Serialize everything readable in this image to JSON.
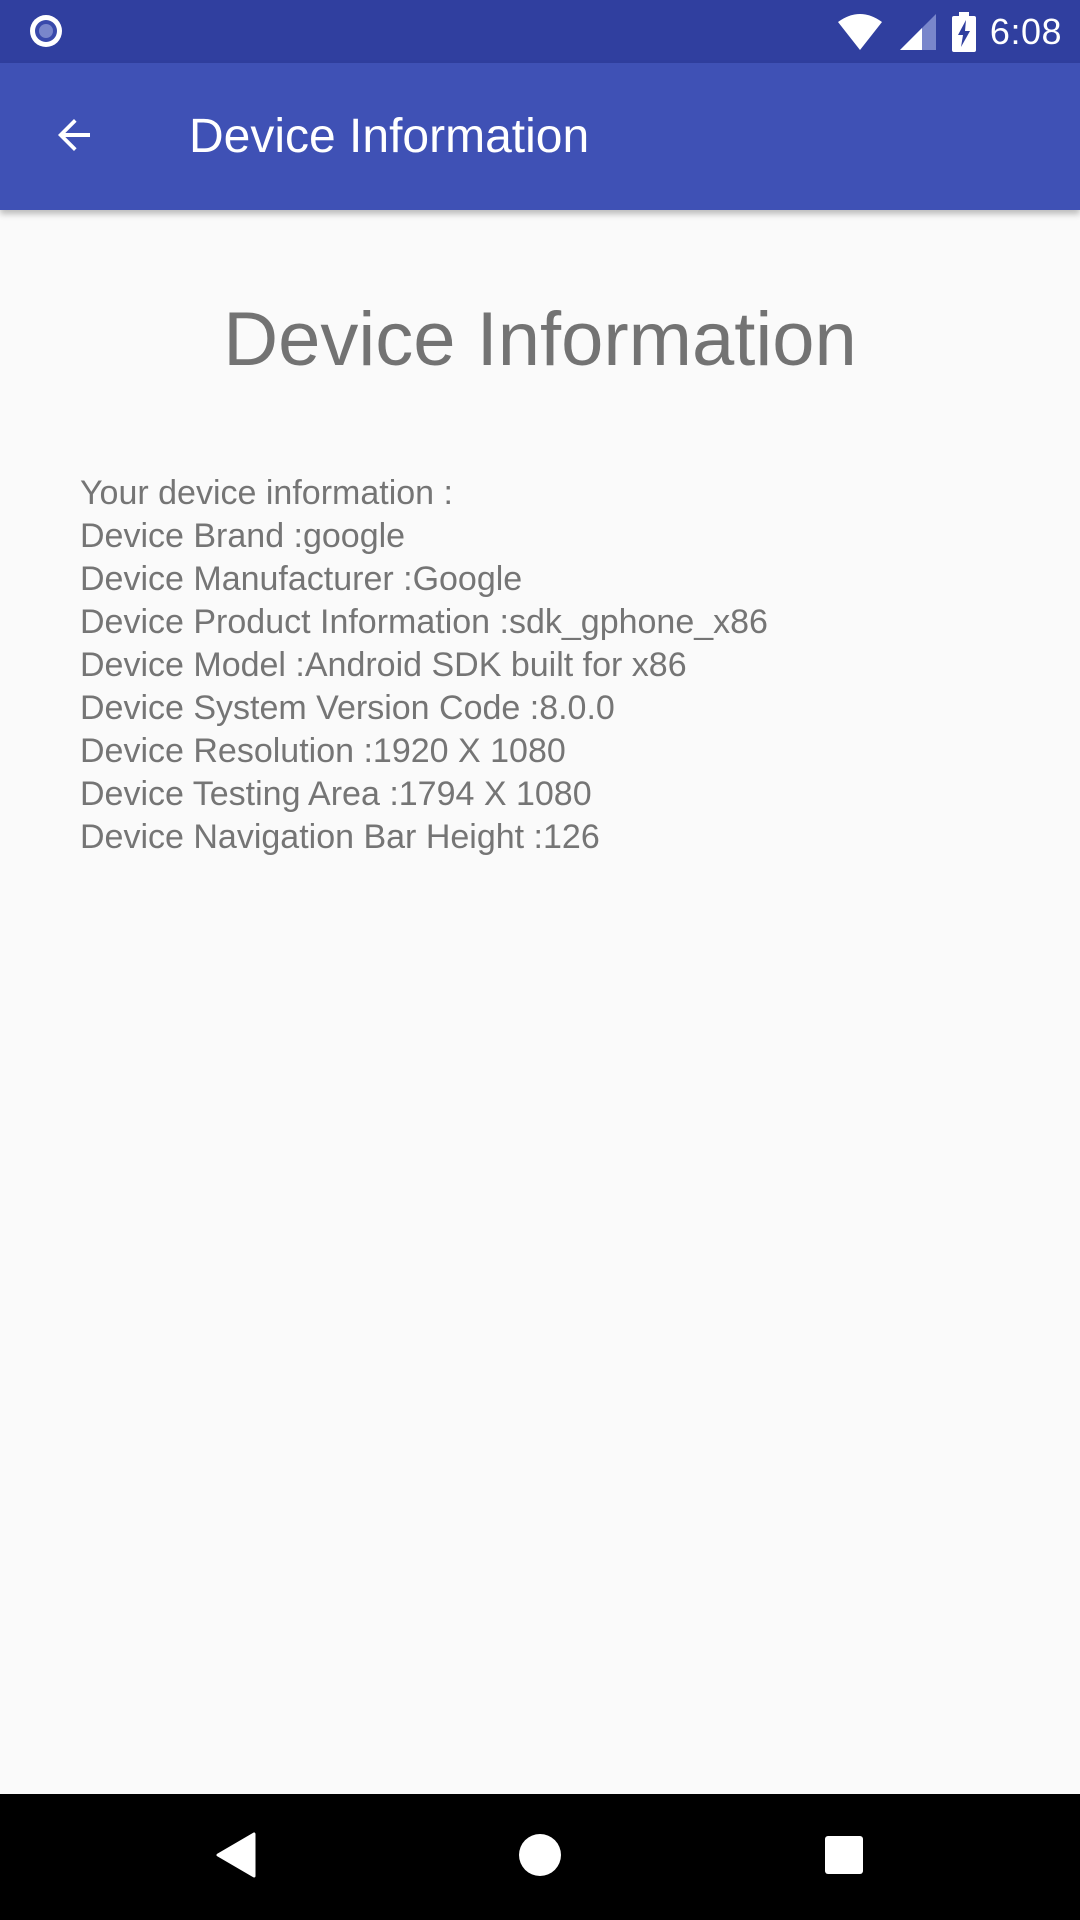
{
  "status_bar": {
    "time": "6:08",
    "left_icon": "sync-circle-icon",
    "icons": [
      "wifi-icon",
      "signal-icon",
      "battery-charging-icon"
    ]
  },
  "app_bar": {
    "title": "Device Information",
    "back_icon": "arrow-back-icon"
  },
  "content": {
    "heading": "Device Information",
    "lines": [
      "Your device information :",
      "Device Brand :google",
      "Device Manufacturer :Google",
      "Device Product Information :sdk_gphone_x86",
      "Device Model :Android SDK built for x86",
      "Device System Version Code :8.0.0",
      "Device Resolution :1920 X 1080",
      "Device Testing Area :1794 X 1080",
      "Device Navigation Bar Height :126"
    ]
  },
  "nav_bar": {
    "buttons": [
      "back-triangle-icon",
      "home-circle-icon",
      "recents-square-icon"
    ]
  },
  "colors": {
    "status_bar": "#303f9f",
    "app_bar": "#3f51b5",
    "background": "#fafafa",
    "text_gray": "#757575",
    "nav_bar": "#000000"
  }
}
